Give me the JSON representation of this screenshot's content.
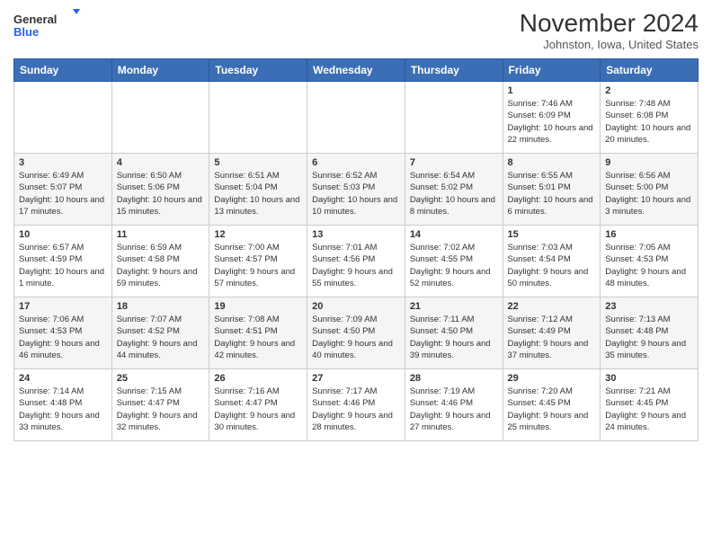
{
  "header": {
    "logo_line1": "General",
    "logo_line2": "Blue",
    "month_title": "November 2024",
    "location": "Johnston, Iowa, United States"
  },
  "days_of_week": [
    "Sunday",
    "Monday",
    "Tuesday",
    "Wednesday",
    "Thursday",
    "Friday",
    "Saturday"
  ],
  "weeks": [
    [
      {
        "num": "",
        "info": ""
      },
      {
        "num": "",
        "info": ""
      },
      {
        "num": "",
        "info": ""
      },
      {
        "num": "",
        "info": ""
      },
      {
        "num": "",
        "info": ""
      },
      {
        "num": "1",
        "info": "Sunrise: 7:46 AM\nSunset: 6:09 PM\nDaylight: 10 hours and 22 minutes."
      },
      {
        "num": "2",
        "info": "Sunrise: 7:48 AM\nSunset: 6:08 PM\nDaylight: 10 hours and 20 minutes."
      }
    ],
    [
      {
        "num": "3",
        "info": "Sunrise: 6:49 AM\nSunset: 5:07 PM\nDaylight: 10 hours and 17 minutes."
      },
      {
        "num": "4",
        "info": "Sunrise: 6:50 AM\nSunset: 5:06 PM\nDaylight: 10 hours and 15 minutes."
      },
      {
        "num": "5",
        "info": "Sunrise: 6:51 AM\nSunset: 5:04 PM\nDaylight: 10 hours and 13 minutes."
      },
      {
        "num": "6",
        "info": "Sunrise: 6:52 AM\nSunset: 5:03 PM\nDaylight: 10 hours and 10 minutes."
      },
      {
        "num": "7",
        "info": "Sunrise: 6:54 AM\nSunset: 5:02 PM\nDaylight: 10 hours and 8 minutes."
      },
      {
        "num": "8",
        "info": "Sunrise: 6:55 AM\nSunset: 5:01 PM\nDaylight: 10 hours and 6 minutes."
      },
      {
        "num": "9",
        "info": "Sunrise: 6:56 AM\nSunset: 5:00 PM\nDaylight: 10 hours and 3 minutes."
      }
    ],
    [
      {
        "num": "10",
        "info": "Sunrise: 6:57 AM\nSunset: 4:59 PM\nDaylight: 10 hours and 1 minute."
      },
      {
        "num": "11",
        "info": "Sunrise: 6:59 AM\nSunset: 4:58 PM\nDaylight: 9 hours and 59 minutes."
      },
      {
        "num": "12",
        "info": "Sunrise: 7:00 AM\nSunset: 4:57 PM\nDaylight: 9 hours and 57 minutes."
      },
      {
        "num": "13",
        "info": "Sunrise: 7:01 AM\nSunset: 4:56 PM\nDaylight: 9 hours and 55 minutes."
      },
      {
        "num": "14",
        "info": "Sunrise: 7:02 AM\nSunset: 4:55 PM\nDaylight: 9 hours and 52 minutes."
      },
      {
        "num": "15",
        "info": "Sunrise: 7:03 AM\nSunset: 4:54 PM\nDaylight: 9 hours and 50 minutes."
      },
      {
        "num": "16",
        "info": "Sunrise: 7:05 AM\nSunset: 4:53 PM\nDaylight: 9 hours and 48 minutes."
      }
    ],
    [
      {
        "num": "17",
        "info": "Sunrise: 7:06 AM\nSunset: 4:53 PM\nDaylight: 9 hours and 46 minutes."
      },
      {
        "num": "18",
        "info": "Sunrise: 7:07 AM\nSunset: 4:52 PM\nDaylight: 9 hours and 44 minutes."
      },
      {
        "num": "19",
        "info": "Sunrise: 7:08 AM\nSunset: 4:51 PM\nDaylight: 9 hours and 42 minutes."
      },
      {
        "num": "20",
        "info": "Sunrise: 7:09 AM\nSunset: 4:50 PM\nDaylight: 9 hours and 40 minutes."
      },
      {
        "num": "21",
        "info": "Sunrise: 7:11 AM\nSunset: 4:50 PM\nDaylight: 9 hours and 39 minutes."
      },
      {
        "num": "22",
        "info": "Sunrise: 7:12 AM\nSunset: 4:49 PM\nDaylight: 9 hours and 37 minutes."
      },
      {
        "num": "23",
        "info": "Sunrise: 7:13 AM\nSunset: 4:48 PM\nDaylight: 9 hours and 35 minutes."
      }
    ],
    [
      {
        "num": "24",
        "info": "Sunrise: 7:14 AM\nSunset: 4:48 PM\nDaylight: 9 hours and 33 minutes."
      },
      {
        "num": "25",
        "info": "Sunrise: 7:15 AM\nSunset: 4:47 PM\nDaylight: 9 hours and 32 minutes."
      },
      {
        "num": "26",
        "info": "Sunrise: 7:16 AM\nSunset: 4:47 PM\nDaylight: 9 hours and 30 minutes."
      },
      {
        "num": "27",
        "info": "Sunrise: 7:17 AM\nSunset: 4:46 PM\nDaylight: 9 hours and 28 minutes."
      },
      {
        "num": "28",
        "info": "Sunrise: 7:19 AM\nSunset: 4:46 PM\nDaylight: 9 hours and 27 minutes."
      },
      {
        "num": "29",
        "info": "Sunrise: 7:20 AM\nSunset: 4:45 PM\nDaylight: 9 hours and 25 minutes."
      },
      {
        "num": "30",
        "info": "Sunrise: 7:21 AM\nSunset: 4:45 PM\nDaylight: 9 hours and 24 minutes."
      }
    ]
  ]
}
